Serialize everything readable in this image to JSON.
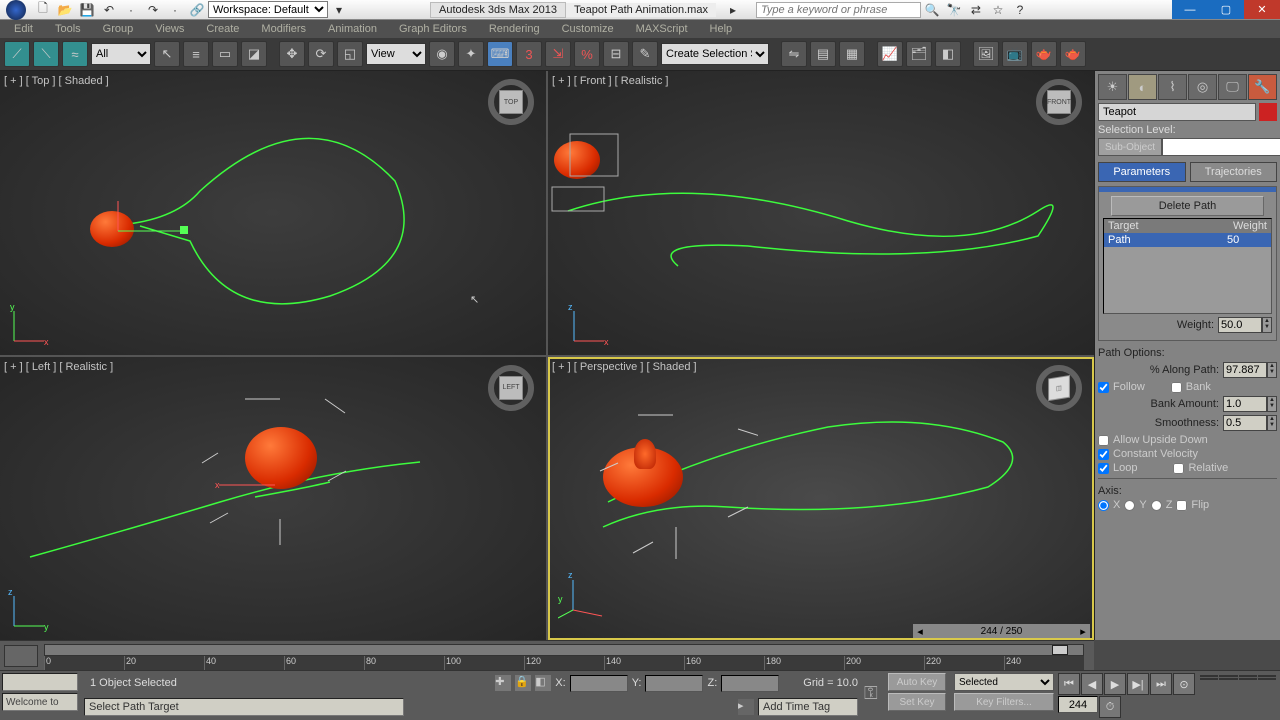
{
  "title": {
    "app": "Autodesk 3ds Max 2013",
    "file": "Teapot Path Animation.max",
    "workspace_label": "Workspace: Default",
    "search_placeholder": "Type a keyword or phrase"
  },
  "menus": [
    "Edit",
    "Tools",
    "Group",
    "Views",
    "Create",
    "Modifiers",
    "Animation",
    "Graph Editors",
    "Rendering",
    "Customize",
    "MAXScript",
    "Help"
  ],
  "toolbar": {
    "sel_filter": "All",
    "ref_coord": "View",
    "named_sel": "Create Selection Se"
  },
  "viewports": {
    "top": "[ + ] [ Top ] [ Shaded ]",
    "front": "[ + ] [ Front ] [ Realistic ]",
    "left": "[ + ] [ Left ] [ Realistic ]",
    "persp": "[ + ] [ Perspective ] [ Shaded ]",
    "cube_top": "TOP",
    "cube_front": "FRONT",
    "cube_left": "LEFT"
  },
  "frame_display": "244 / 250",
  "ruler": [
    "0",
    "20",
    "40",
    "60",
    "80",
    "100",
    "120",
    "140",
    "160",
    "180",
    "200",
    "220",
    "240"
  ],
  "cmd": {
    "object_name": "Teapot",
    "sel_level": "Selection Level:",
    "sub_object": "Sub-Object",
    "tab_params": "Parameters",
    "tab_traj": "Trajectories",
    "delete_path": "Delete Path",
    "col_target": "Target",
    "col_weight": "Weight",
    "row_target": "Path",
    "row_weight": "50",
    "weight_label": "Weight:",
    "weight_value": "50.0",
    "path_options": "Path Options:",
    "pct_along": "% Along Path:",
    "pct_value": "97.887",
    "follow": "Follow",
    "bank": "Bank",
    "bank_amount": "Bank Amount:",
    "bank_value": "1.0",
    "smoothness": "Smoothness:",
    "smooth_value": "0.5",
    "upside": "Allow Upside Down",
    "constvel": "Constant Velocity",
    "loop": "Loop",
    "relative": "Relative",
    "axis": "Axis:",
    "x": "X",
    "y": "Y",
    "z": "Z",
    "flip": "Flip"
  },
  "status": {
    "welcome": "Welcome to",
    "objects": "1 Object Selected",
    "x": "X:",
    "y": "Y:",
    "z": "Z:",
    "grid": "Grid = 10.0",
    "prompt": "Select Path Target",
    "add_tag": "Add Time Tag",
    "autokey": "Auto Key",
    "setkey": "Set Key",
    "selected": "Selected",
    "keyfilters": "Key Filters...",
    "frame": "244"
  }
}
